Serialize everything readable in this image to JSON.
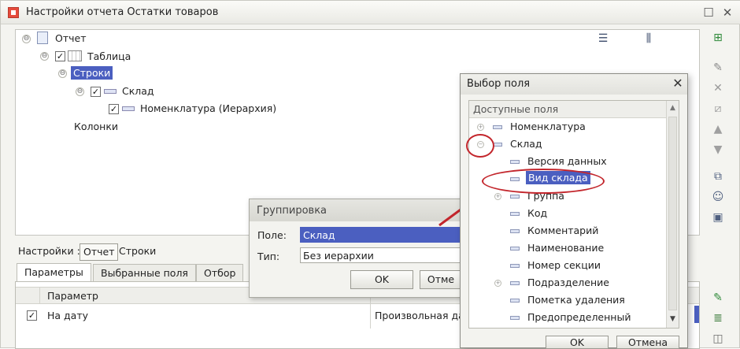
{
  "window": {
    "title": "Настройки отчета  Остатки товаров",
    "restore_glyph": "☐",
    "close_glyph": "✕"
  },
  "tree": {
    "root": "Отчет",
    "table": "Таблица",
    "rows": "Строки",
    "group_sklad": "Склад",
    "group_nomenclature": "Номенклатура (Иерархия)",
    "columns": "Колонки",
    "expanded_glyph": "⊖",
    "check_glyph": "✓"
  },
  "settings": {
    "label": "Настройки :",
    "report_button": "Отчет",
    "rows_button": "Строки"
  },
  "tabs": [
    "Параметры",
    "Выбранные поля",
    "Отбор"
  ],
  "params_grid": {
    "header_param": "Параметр",
    "row_name": "На дату",
    "row_value": "Произвольная дат",
    "row_checked": true
  },
  "grouping_dialog": {
    "title": "Группировка",
    "field_label": "Поле:",
    "field_value": "Склад",
    "type_label": "Тип:",
    "type_value": "Без иерархии",
    "ok_button": "OK",
    "cancel_button": "Отме"
  },
  "field_picker": {
    "title": "Выбор поля",
    "header": "Доступные поля",
    "items": [
      {
        "label": "Номенклатура"
      },
      {
        "label": "Склад"
      },
      {
        "label": "Версия данных"
      },
      {
        "label": "Вид склада"
      },
      {
        "label": "Группа"
      },
      {
        "label": "Код"
      },
      {
        "label": "Комментарий"
      },
      {
        "label": "Наименование"
      },
      {
        "label": "Номер секции"
      },
      {
        "label": "Подразделение"
      },
      {
        "label": "Пометка удаления"
      },
      {
        "label": "Предопределенный"
      }
    ],
    "ok_button": "OK",
    "cancel_button": "Отмена"
  },
  "colors": {
    "selection": "#4b5fc0",
    "annotation": "#c3262c"
  }
}
